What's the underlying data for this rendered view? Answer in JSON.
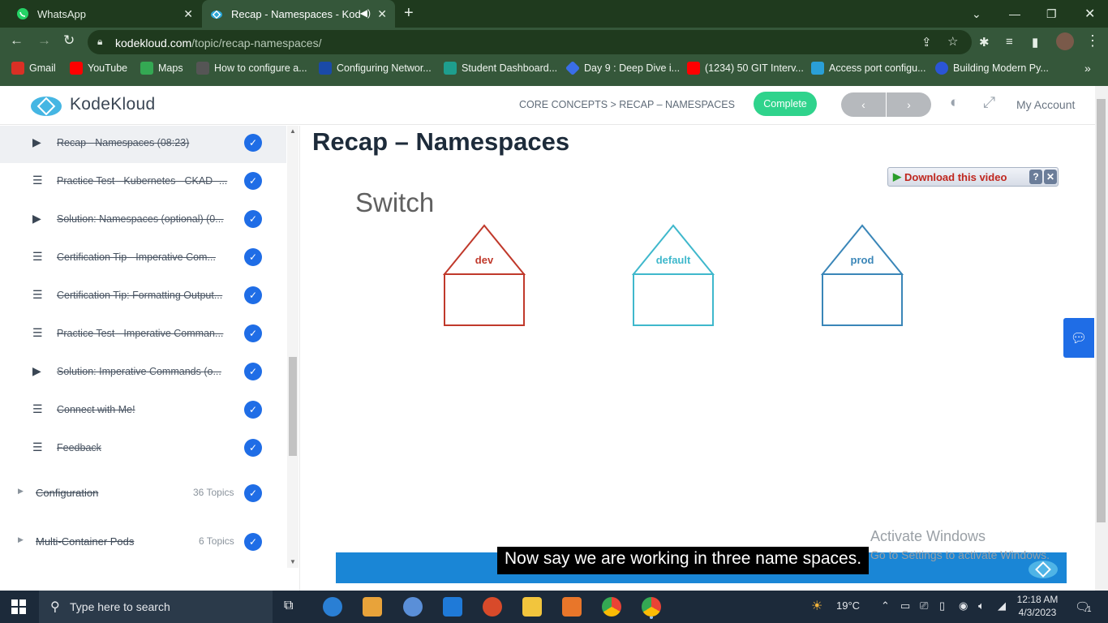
{
  "browser": {
    "tabs": [
      {
        "title": "WhatsApp",
        "icon": "whatsapp-icon"
      },
      {
        "title": "Recap - Namespaces - KodeK",
        "icon": "kodekloud-icon"
      }
    ],
    "url_domain": "kodekloud.com",
    "url_path": "/topic/recap-namespaces/",
    "bookmarks": [
      {
        "label": "Gmail",
        "color": "#d93025"
      },
      {
        "label": "YouTube",
        "color": "#ff0000"
      },
      {
        "label": "Maps",
        "color": "#34a853"
      },
      {
        "label": "How to configure a...",
        "color": "#555555"
      },
      {
        "label": "Configuring Networ...",
        "color": "#1a4aa8"
      },
      {
        "label": "Student Dashboard...",
        "color": "#1e9e8e"
      },
      {
        "label": "Day 9 : Deep Dive i...",
        "color": "#3a6ee8"
      },
      {
        "label": "(1234) 50 GIT Interv...",
        "color": "#ff0000"
      },
      {
        "label": "Access port configu...",
        "color": "#2a9fd6"
      },
      {
        "label": "Building Modern Py...",
        "color": "#2b55d6"
      }
    ]
  },
  "site": {
    "brand": "KodeKloud",
    "breadcrumb": "CORE CONCEPTS > RECAP – NAMESPACES",
    "complete_label": "Complete",
    "prev_label": "‹",
    "next_label": "›",
    "account_label": "My Account"
  },
  "sidebar": {
    "lessons": [
      {
        "type": "video",
        "label": "Recap - Namespaces (08:23)"
      },
      {
        "type": "quiz",
        "label": "Practice Test - Kubernetes - CKAD -..."
      },
      {
        "type": "video",
        "label": "Solution: Namespaces (optional) (0..."
      },
      {
        "type": "quiz",
        "label": "Certification Tip - Imperative Com..."
      },
      {
        "type": "quiz",
        "label": "Certification Tip: Formatting Output..."
      },
      {
        "type": "quiz",
        "label": "Practice Test - Imperative Comman..."
      },
      {
        "type": "video",
        "label": "Solution: Imperative Commands (o..."
      },
      {
        "type": "quiz",
        "label": "Connect with Me!"
      },
      {
        "type": "quiz",
        "label": "Feedback"
      }
    ],
    "sections": [
      {
        "label": "Configuration",
        "count": "36 Topics"
      },
      {
        "label": "Multi-Container Pods",
        "count": "6 Topics"
      }
    ]
  },
  "main": {
    "title": "Recap – Namespaces",
    "download_label": "Download this video",
    "slide_heading": "Switch",
    "houses": [
      {
        "label": "dev",
        "color": "#c0392b"
      },
      {
        "label": "default",
        "color": "#3fb8cc"
      },
      {
        "label": "prod",
        "color": "#3a86b8"
      }
    ],
    "caption": "Now say we are working in three name spaces.",
    "watermark_line1": "Activate Windows",
    "watermark_line2": "Go to Settings to activate Windows."
  },
  "taskbar": {
    "search_placeholder": "Type here to search",
    "temperature": "19°C",
    "time": "12:18 AM",
    "date": "4/3/2023",
    "notification_count": "1"
  }
}
